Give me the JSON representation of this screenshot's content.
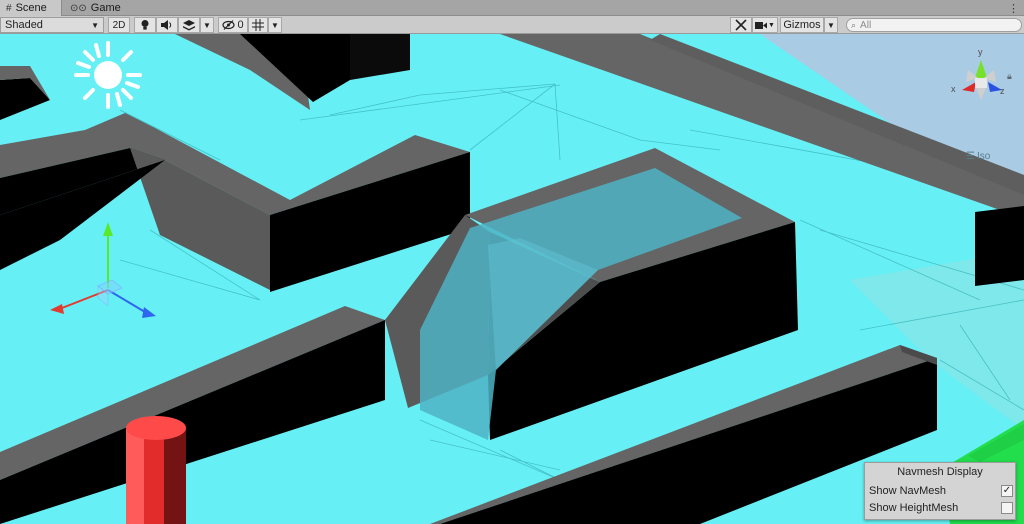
{
  "tabs": [
    {
      "label": "Scene",
      "icon": "hash-icon"
    },
    {
      "label": "Game",
      "icon": "gamepad-icon"
    }
  ],
  "toolbar": {
    "draw_mode": "Shaded",
    "mode_2d": "2D",
    "hidden_count": "0",
    "gizmos": "Gizmos",
    "search_placeholder": "All"
  },
  "viewport": {
    "projection_label": "Iso",
    "navmesh_color": "#66f0f5",
    "wall_top_color": "#656565",
    "wall_front_color": "#000000",
    "ground_color": "#7ee8ea",
    "sky_color": "#a9cbe4",
    "grass_color": "#22dd4c",
    "cylinder_color": "#ff4a4a"
  },
  "navmesh_panel": {
    "title": "Navmesh Display",
    "show_navmesh": {
      "label": "Show NavMesh",
      "checked": true
    },
    "show_heightmesh": {
      "label": "Show HeightMesh",
      "checked": false
    }
  }
}
